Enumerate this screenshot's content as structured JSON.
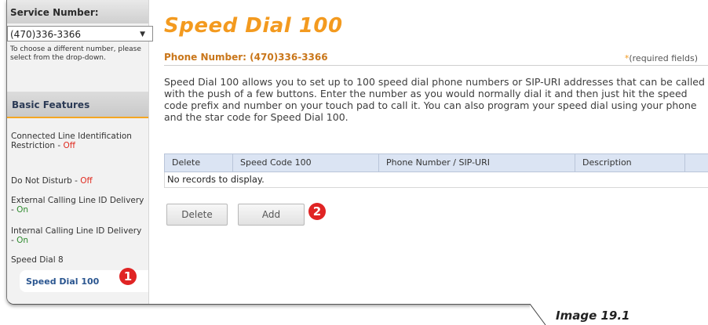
{
  "sidebar": {
    "service_number_heading": "Service Number:",
    "selected_number": "(470)336-3366",
    "hint": "To choose a different number, please select from the drop-down.",
    "basic_features_heading": "Basic Features",
    "items": [
      {
        "label": "Connected Line Identification Restriction",
        "status": "Off"
      },
      {
        "label": "Do Not Disturb",
        "status": "Off"
      },
      {
        "label": "External Calling Line ID Delivery",
        "status": "On"
      },
      {
        "label": "Internal Calling Line ID Delivery",
        "status": "On"
      },
      {
        "label": "Speed Dial 8",
        "status": ""
      },
      {
        "label": "Speed Dial 100",
        "status": ""
      }
    ],
    "status_separator": " - "
  },
  "main": {
    "title": "Speed Dial 100",
    "phone_number_label": "Phone Number: (470)336-3366",
    "required_star": "*",
    "required_text": "(required fields)",
    "description": "Speed Dial 100 allows you to set up to 100 speed dial phone numbers or SIP-URI addresses that can be called with the push of a few buttons. Enter the number as you would normally dial it and then just hit the speed code prefix and number on your touch pad to call it. You can also program your speed dial using your phone and the star code for Speed Dial 100.",
    "table": {
      "columns": [
        "Delete",
        "Speed Code 100",
        "Phone Number / SIP-URI",
        "Description"
      ],
      "empty_message": "No records to display."
    },
    "buttons": {
      "delete": "Delete",
      "add": "Add"
    }
  },
  "callouts": {
    "one": "1",
    "two": "2"
  },
  "caption": "Image 19.1",
  "colors": {
    "title_orange": "#f39a1f",
    "phone_orange": "#c9761a",
    "off_red": "#e02b20",
    "on_green": "#2e8b2e",
    "table_header_blue": "#dbe4f3",
    "badge_red": "#e02424"
  },
  "icons": {
    "dropdown_arrow": "chevron-down-icon"
  }
}
